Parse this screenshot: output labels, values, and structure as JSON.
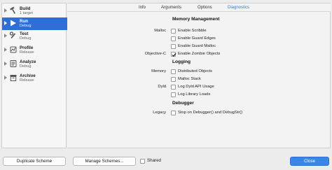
{
  "sidebar": {
    "items": [
      {
        "name": "Build",
        "sub": "1 target"
      },
      {
        "name": "Run",
        "sub": "Debug"
      },
      {
        "name": "Test",
        "sub": "Debug"
      },
      {
        "name": "Profile",
        "sub": "Release"
      },
      {
        "name": "Analyze",
        "sub": "Debug"
      },
      {
        "name": "Archive",
        "sub": "Release"
      }
    ]
  },
  "tabs": [
    "Info",
    "Arguments",
    "Options",
    "Diagnostics"
  ],
  "active_tab": "Diagnostics",
  "sections": {
    "memory_management": {
      "title": "Memory Management",
      "malloc_label": "Malloc",
      "objc_label": "Objective-C",
      "enable_scribble": "Enable Scribble",
      "enable_guard_edges": "Enable Guard Edges",
      "enable_guard_malloc": "Enable Guard Malloc",
      "enable_zombie_objects": "Enable Zombie Objects"
    },
    "logging": {
      "title": "Logging",
      "memory_label": "Memory",
      "dyld_label": "Dyld",
      "distributed_objects": "Distributed Objects",
      "malloc_stack": "Malloc Stack",
      "log_dyld_api": "Log Dyld API Usage",
      "log_library_loads": "Log Library Loads"
    },
    "debugger": {
      "title": "Debugger",
      "legacy_label": "Legacy",
      "stop_on_debugger": "Stop on Debugger() and DebugStr()"
    }
  },
  "footer": {
    "duplicate_scheme": "Duplicate Scheme",
    "manage_schemes": "Manage Schemes...",
    "shared": "Shared",
    "close": "Close"
  },
  "colors": {
    "accent": "#2f6fd5",
    "active_tab": "#2f7bd9"
  }
}
